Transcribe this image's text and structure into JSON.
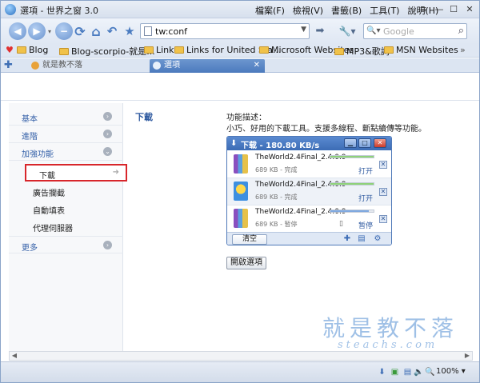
{
  "window": {
    "title": "選項 - 世界之窗 3.0",
    "menu": [
      "檔案(F)",
      "檢視(V)",
      "書籤(B)",
      "工具(T)",
      "說明(H)"
    ]
  },
  "nav": {
    "url": "tw:conf",
    "search_placeholder": "Google"
  },
  "bookmarks": [
    "Blog",
    "Blog-scorpio-就是...",
    "Links",
    "Links for United Sta...",
    "Microsoft Websites",
    "MP3&歌詞",
    "MSN Websites"
  ],
  "tabs": [
    {
      "label": "就是教不落"
    },
    {
      "label": "選項"
    }
  ],
  "sidebar": {
    "items": [
      {
        "label": "基本"
      },
      {
        "label": "進階"
      },
      {
        "label": "加強功能"
      }
    ],
    "subitems": [
      "下載",
      "廣告攔截",
      "自動填表",
      "代理伺服器"
    ],
    "more": "更多"
  },
  "main": {
    "section_title": "下載",
    "desc_head": "功能描述：",
    "desc_body": "小巧、好用的下載工具。支援多線程、斷點續傳等功能。",
    "open_button": "開啟選項"
  },
  "download_window": {
    "title": "下载 - 180.80 KB/s",
    "rows": [
      {
        "name": "TheWorld2.4Final_2.4.0.9",
        "meta": "689 KB - 完成",
        "action": "打开",
        "progress": 1.0,
        "color": "#8fd27a"
      },
      {
        "name": "TheWorld2.4Final_2.4.0.9",
        "meta": "689 KB - 完成",
        "action": "打开",
        "progress": 1.0,
        "color": "#8fd27a"
      },
      {
        "name": "TheWorld2.4Final_2.4.0.9",
        "meta": "689 KB - 暂停",
        "action": "暂停",
        "progress": 0.88,
        "color": "#7fa9e0"
      }
    ],
    "clear_label": "清空"
  },
  "watermark": {
    "main": "就是教不落",
    "sub": "steachs.com"
  },
  "status": {
    "zoom": "100%"
  }
}
